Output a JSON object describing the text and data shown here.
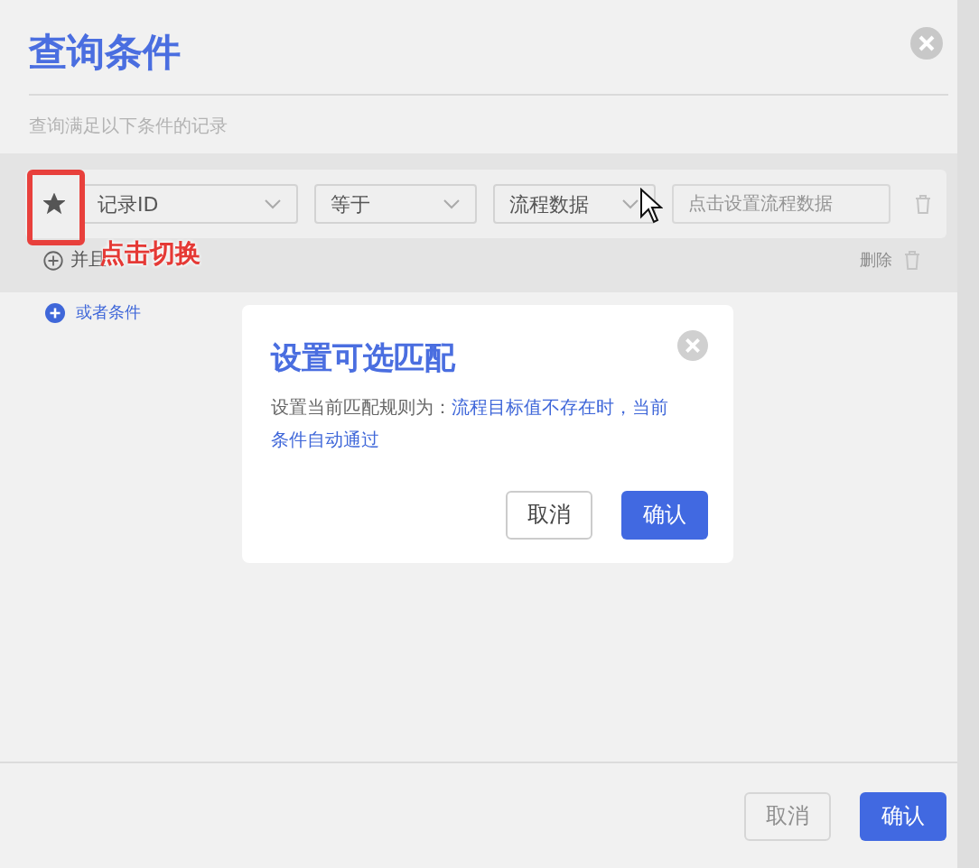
{
  "dialog": {
    "title": "查询条件",
    "subtitle": "查询满足以下条件的记录",
    "condition": {
      "optional": true,
      "field": "记录ID",
      "operator": "等于",
      "value_source": "流程数据",
      "value_placeholder": "点击设置流程数据"
    },
    "and_label": "并且",
    "delete_label": "删除",
    "or_label": "或者条件",
    "buttons": [
      {
        "label": "取消",
        "kind": "secondary",
        "disabled": true
      },
      {
        "label": "确认",
        "kind": "primary",
        "disabled": false
      }
    ]
  },
  "annotation": {
    "label": "点击切换"
  },
  "modal": {
    "title": "设置可选匹配",
    "text_prefix": "设置当前匹配规则为：",
    "text_highlight": "流程目标值不存在时，当前条件自动通过",
    "buttons": [
      {
        "label": "取消",
        "kind": "secondary",
        "disabled": false
      },
      {
        "label": "确认",
        "kind": "primary",
        "disabled": false
      }
    ]
  }
}
